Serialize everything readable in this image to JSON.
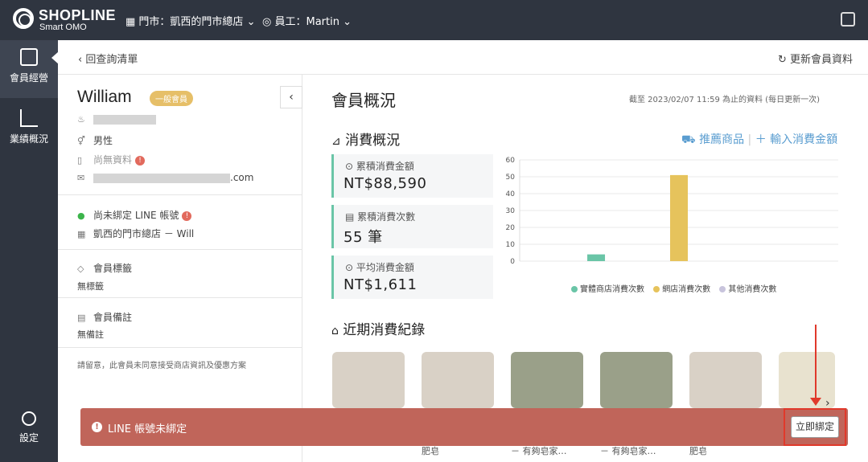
{
  "topbar": {
    "brand": "SHOPLINE",
    "brand_sub": "Smart OMO",
    "store_label": "門市：凱西的門市總店",
    "staff_label": "員工：Martin"
  },
  "sidebar": {
    "items": [
      {
        "label": "會員經營"
      },
      {
        "label": "業績概況"
      }
    ],
    "settings_label": "設定"
  },
  "header": {
    "back_label": "回查詢清單",
    "refresh_label": "更新會員資料"
  },
  "member": {
    "name": "William",
    "tier": "一般會員",
    "gender": "男性",
    "phone": "尚無資料",
    "email_suffix": ".com",
    "line_status": "尚未綁定 LINE 帳號",
    "store": "凱西的門市總店 － Will",
    "tags_title": "會員標籤",
    "tags_value": "無標籤",
    "notes_title": "會員備註",
    "notes_value": "無備註",
    "notice": "請留意，此會員未同意接受商店資訊及優惠方案"
  },
  "overview": {
    "title": "會員概況",
    "as_of": "截至 2023/02/07 11:59 為止的資料 (每日更新一次)",
    "consumption_title": "消費概況",
    "recommend_label": "推薦商品",
    "input_label": "＋ 輸入消費金額",
    "stats": [
      {
        "label": "累積消費金額",
        "value": "NT$88,590"
      },
      {
        "label": "累積消費次數",
        "value": "55 筆"
      },
      {
        "label": "平均消費金額",
        "value": "NT$1,611"
      }
    ],
    "recent_title": "近期消費紀錄"
  },
  "chart_data": {
    "type": "bar",
    "categories": [
      "實體商店消費次數",
      "網店消費次數",
      "其他消費次數"
    ],
    "values": [
      4,
      51,
      0
    ],
    "colors": [
      "#6ac5a7",
      "#e6c35c",
      "#c8c4dc"
    ],
    "ylim": [
      0,
      60
    ],
    "yticks": [
      "0",
      "10",
      "20",
      "30",
      "40",
      "50",
      "60"
    ],
    "legend": [
      "實體商店消費次數",
      "網店消費次數",
      "其他消費次數"
    ],
    "legend_position": "bottom"
  },
  "products": {
    "captions": [
      "肥皂",
      "－ 有夠皂家…",
      "－ 有夠皂家…",
      "肥皂"
    ]
  },
  "banner": {
    "message": "LINE 帳號未綁定",
    "bind_label": "立即綁定"
  }
}
